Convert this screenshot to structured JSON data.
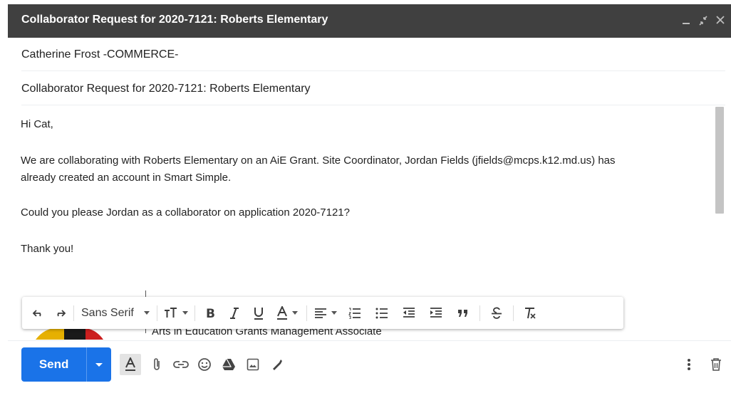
{
  "window": {
    "title": "Collaborator Request for 2020-7121: Roberts Elementary",
    "controls": [
      "minimize-icon",
      "exit-fullscreen-icon",
      "close-icon"
    ]
  },
  "compose": {
    "to": "Catherine Frost -COMMERCE-",
    "subject": "Collaborator Request for 2020-7121: Roberts Elementary",
    "body": {
      "greeting": "Hi Cat,",
      "para1_line1": "We are collaborating with Roberts Elementary on an AiE Grant. Site Coordinator, Jordan Fields (jfields@mcps.k12.md.us) has",
      "para1_line2": "already created an account in Smart Simple.",
      "para2": "Could you please Jordan as a collaborator on application 2020-7121?",
      "closing": "Thank you!"
    },
    "signature_partial": "Arts in Education Grants Management Associate"
  },
  "format_toolbar": {
    "font_family": "Sans Serif",
    "icons": [
      "undo-icon",
      "redo-icon",
      "font-size-icon",
      "bold-icon",
      "italic-icon",
      "underline-icon",
      "text-color-icon",
      "align-icon",
      "numbered-list-icon",
      "bulleted-list-icon",
      "indent-less-icon",
      "indent-more-icon",
      "quote-icon",
      "strikethrough-icon",
      "remove-formatting-icon"
    ]
  },
  "bottom_toolbar": {
    "send_label": "Send",
    "icons": [
      "formatting-options-icon",
      "attach-icon",
      "insert-link-icon",
      "emoji-icon",
      "drive-icon",
      "insert-photo-icon",
      "signature-icon",
      "more-options-icon",
      "discard-draft-icon"
    ]
  },
  "colors": {
    "titlebar": "#404040",
    "send_blue": "#1a73e8",
    "text": "#222222"
  }
}
